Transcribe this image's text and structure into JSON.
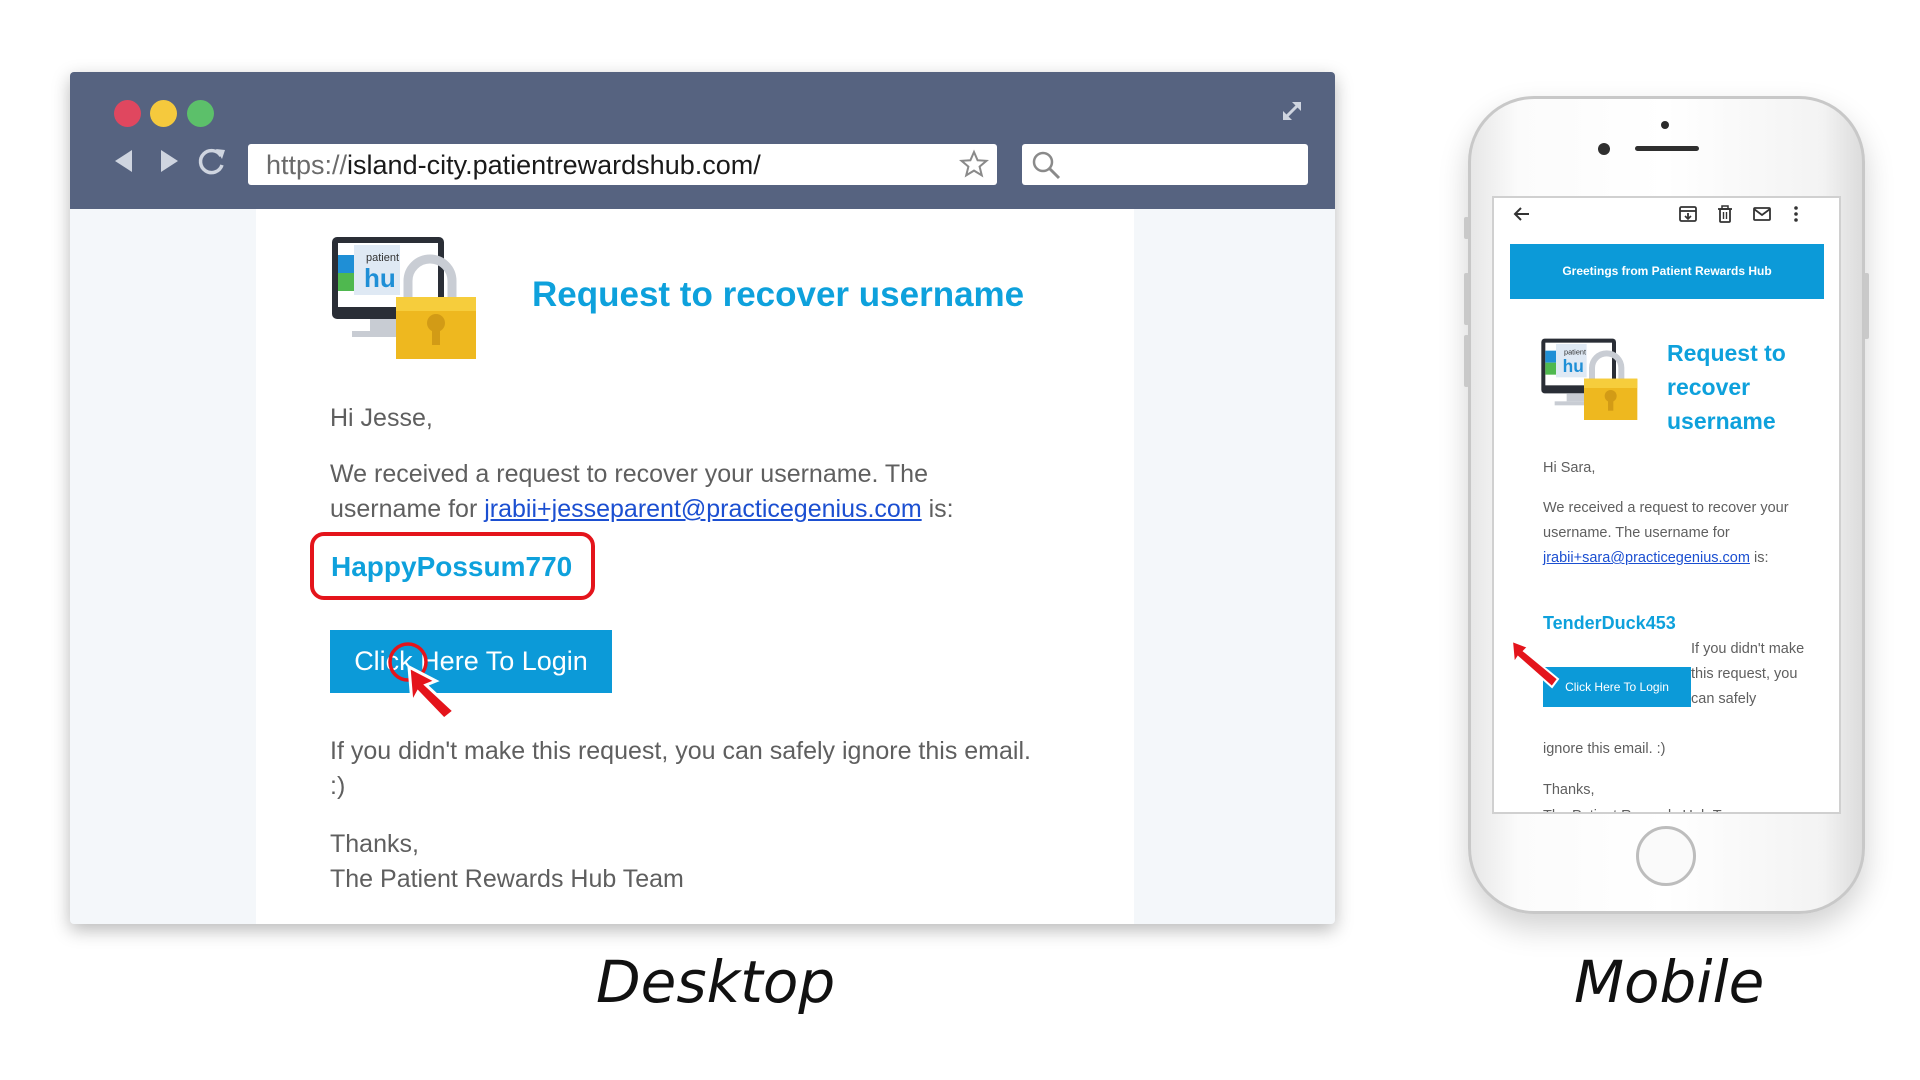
{
  "desktop": {
    "url": {
      "protocol": "https://",
      "host": "island-city.patientrewardshub.com/"
    },
    "email": {
      "title": "Request to recover username",
      "greeting": "Hi Jesse,",
      "body_before": "We received a request to recover your username. The username for ",
      "email_link": "jrabii+jesseparent@practicegenius.com",
      "body_after": " is:",
      "username": "HappyPossum770",
      "login_button": "Click Here To Login",
      "ignore_text": "If you didn't make this request, you can safely ignore this email. :)",
      "thanks": "Thanks,",
      "signature": "The Patient Rewards Hub Team"
    },
    "caption": "Desktop"
  },
  "mobile": {
    "banner": "Greetings from Patient Rewards Hub",
    "email": {
      "title": "Request to recover username",
      "greeting": "Hi Sara,",
      "body_before": "We received a request to recover your username. The username for ",
      "email_link": "jrabii+sara@practicegenius.com",
      "body_after": " is:",
      "username": "TenderDuck453",
      "login_button": "Click Here To Login",
      "ignore_side": "If you didn't make this request, you can safely",
      "ignore_end": "ignore this email. :)",
      "thanks": "Thanks,",
      "signature": "The Patient Rewards Hub Team"
    },
    "caption": "Mobile"
  },
  "icons": {
    "nav_back": "arrow-left-icon",
    "nav_forward": "arrow-right-icon",
    "reload": "reload-icon",
    "bookmark": "star-icon",
    "search": "search-icon",
    "expand": "expand-icon",
    "mobile_back": "back-arrow-icon",
    "archive": "archive-icon",
    "trash": "trash-icon",
    "mail": "mail-icon",
    "more": "more-vertical-icon"
  },
  "colors": {
    "accent": "#0ea1dc",
    "button": "#0c9ad8",
    "chrome": "#566380",
    "highlight": "#e4141b",
    "link": "#1b4fd1"
  }
}
